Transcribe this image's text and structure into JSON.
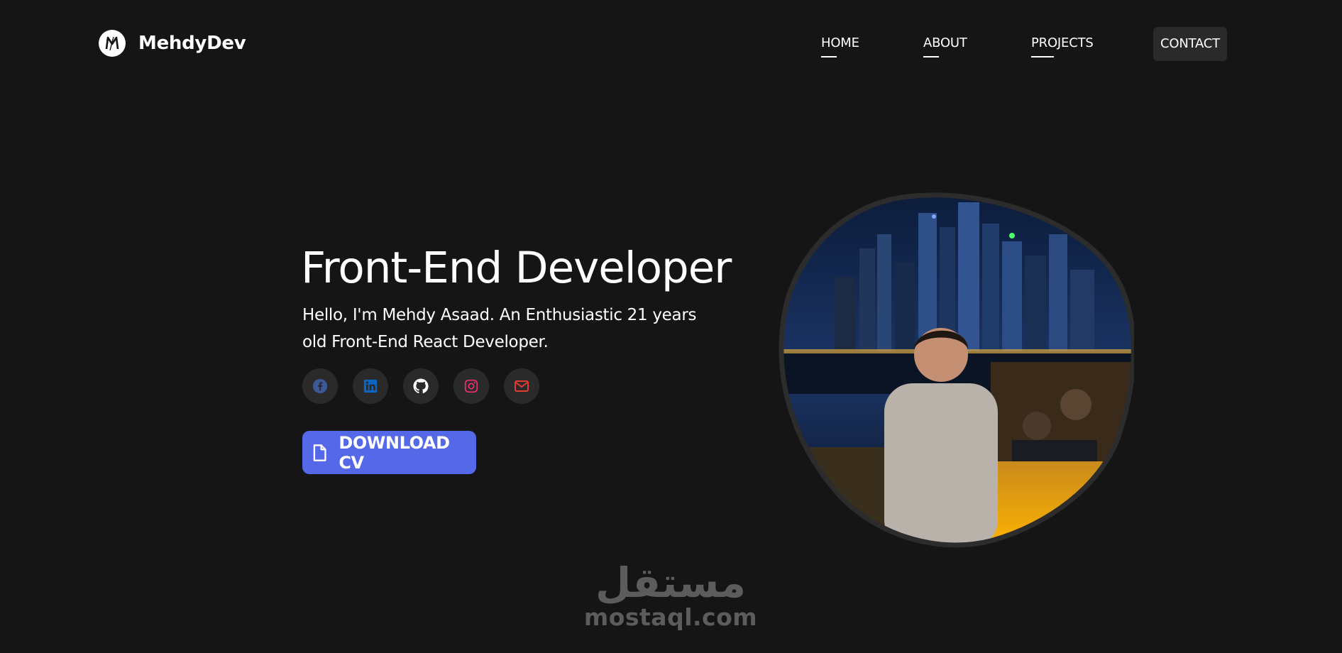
{
  "header": {
    "brand_name": "MehdyDev",
    "brand_logo_letter": "M",
    "nav": [
      {
        "label": "HOME",
        "icon": null
      },
      {
        "label": "ABOUT",
        "icon": null
      },
      {
        "label": "PROJECTS",
        "icon": null
      },
      {
        "label": "CONTACT",
        "icon": null
      }
    ]
  },
  "hero": {
    "title": "Front-End Developer",
    "subtitle": "Hello, I'm Mehdy Asaad. An Enthusiastic 21 years old Front-End React Developer.",
    "socials": [
      {
        "name": "facebook-icon",
        "color": "#3b5998"
      },
      {
        "name": "linkedin-icon",
        "color": "#0a66c2"
      },
      {
        "name": "github-icon",
        "color": "#ffffff"
      },
      {
        "name": "instagram-icon",
        "color": "#e1306c"
      },
      {
        "name": "mail-icon",
        "color": "#e53935"
      }
    ],
    "cv_button_label": "DOWNLOAD CV",
    "cv_button_color": "#5568e8"
  },
  "watermark": {
    "arabic": "مستقل",
    "latin": "mostaql.com"
  },
  "colors": {
    "background": "#151515",
    "surface": "#2a2a2a",
    "accent": "#5568e8"
  }
}
